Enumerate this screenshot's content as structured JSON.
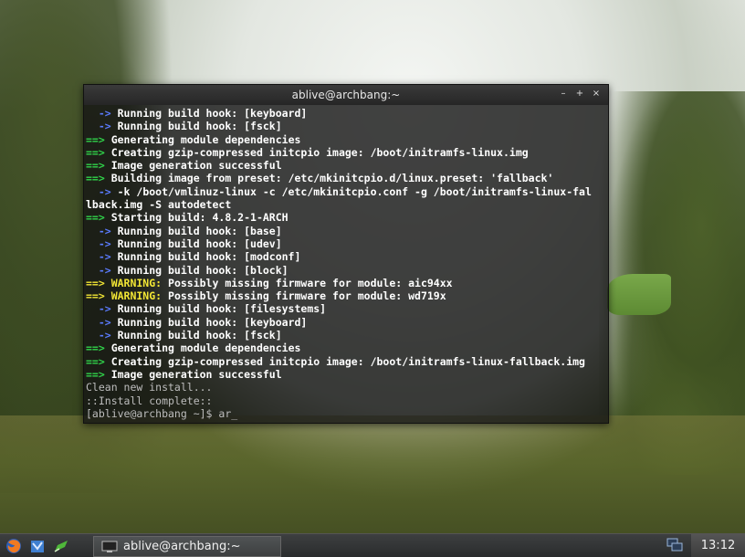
{
  "window": {
    "title": "ablive@archbang:~",
    "controls": {
      "minimize": "–",
      "maximize": "+",
      "close": "×"
    }
  },
  "terminal": {
    "lines": [
      [
        {
          "c": "b",
          "t": "  -> "
        },
        {
          "c": "w",
          "t": "Running build hook: [keyboard]"
        }
      ],
      [
        {
          "c": "b",
          "t": "  -> "
        },
        {
          "c": "w",
          "t": "Running build hook: [fsck]"
        }
      ],
      [
        {
          "c": "g",
          "t": "==> "
        },
        {
          "c": "w",
          "t": "Generating module dependencies"
        }
      ],
      [
        {
          "c": "g",
          "t": "==> "
        },
        {
          "c": "w",
          "t": "Creating gzip-compressed initcpio image: /boot/initramfs-linux.img"
        }
      ],
      [
        {
          "c": "g",
          "t": "==> "
        },
        {
          "c": "w",
          "t": "Image generation successful"
        }
      ],
      [
        {
          "c": "g",
          "t": "==> "
        },
        {
          "c": "w",
          "t": "Building image from preset: /etc/mkinitcpio.d/linux.preset: 'fallback'"
        }
      ],
      [
        {
          "c": "b",
          "t": "  -> "
        },
        {
          "c": "w",
          "t": "-k /boot/vmlinuz-linux -c /etc/mkinitcpio.conf -g /boot/initramfs-linux-fal"
        }
      ],
      [
        {
          "c": "w",
          "t": "lback.img -S autodetect"
        }
      ],
      [
        {
          "c": "g",
          "t": "==> "
        },
        {
          "c": "w",
          "t": "Starting build: 4.8.2-1-ARCH"
        }
      ],
      [
        {
          "c": "b",
          "t": "  -> "
        },
        {
          "c": "w",
          "t": "Running build hook: [base]"
        }
      ],
      [
        {
          "c": "b",
          "t": "  -> "
        },
        {
          "c": "w",
          "t": "Running build hook: [udev]"
        }
      ],
      [
        {
          "c": "b",
          "t": "  -> "
        },
        {
          "c": "w",
          "t": "Running build hook: [modconf]"
        }
      ],
      [
        {
          "c": "b",
          "t": "  -> "
        },
        {
          "c": "w",
          "t": "Running build hook: [block]"
        }
      ],
      [
        {
          "c": "y",
          "t": "==> WARNING: "
        },
        {
          "c": "w",
          "t": "Possibly missing firmware for module: aic94xx"
        }
      ],
      [
        {
          "c": "y",
          "t": "==> WARNING: "
        },
        {
          "c": "w",
          "t": "Possibly missing firmware for module: wd719x"
        }
      ],
      [
        {
          "c": "b",
          "t": "  -> "
        },
        {
          "c": "w",
          "t": "Running build hook: [filesystems]"
        }
      ],
      [
        {
          "c": "b",
          "t": "  -> "
        },
        {
          "c": "w",
          "t": "Running build hook: [keyboard]"
        }
      ],
      [
        {
          "c": "b",
          "t": "  -> "
        },
        {
          "c": "w",
          "t": "Running build hook: [fsck]"
        }
      ],
      [
        {
          "c": "g",
          "t": "==> "
        },
        {
          "c": "w",
          "t": "Generating module dependencies"
        }
      ],
      [
        {
          "c": "g",
          "t": "==> "
        },
        {
          "c": "w",
          "t": "Creating gzip-compressed initcpio image: /boot/initramfs-linux-fallback.img"
        }
      ],
      [
        {
          "c": "g",
          "t": "==> "
        },
        {
          "c": "w",
          "t": "Image generation successful"
        }
      ],
      [
        {
          "c": "dim",
          "t": "Clean new install..."
        }
      ],
      [
        {
          "c": "dim",
          "t": "::Install complete::"
        }
      ],
      [
        {
          "c": "dim",
          "t": "[ablive@archbang ~]$ ar_"
        }
      ]
    ]
  },
  "taskbar": {
    "launchers": [
      {
        "name": "firefox-icon"
      },
      {
        "name": "file-manager-icon"
      },
      {
        "name": "edit-icon"
      }
    ],
    "task_label": "ablive@archbang:~",
    "clock": "13:12"
  },
  "colors": {
    "prompt_green": "#30d44a",
    "arrow_blue": "#5b7cff",
    "warning_yellow": "#f2e635"
  }
}
